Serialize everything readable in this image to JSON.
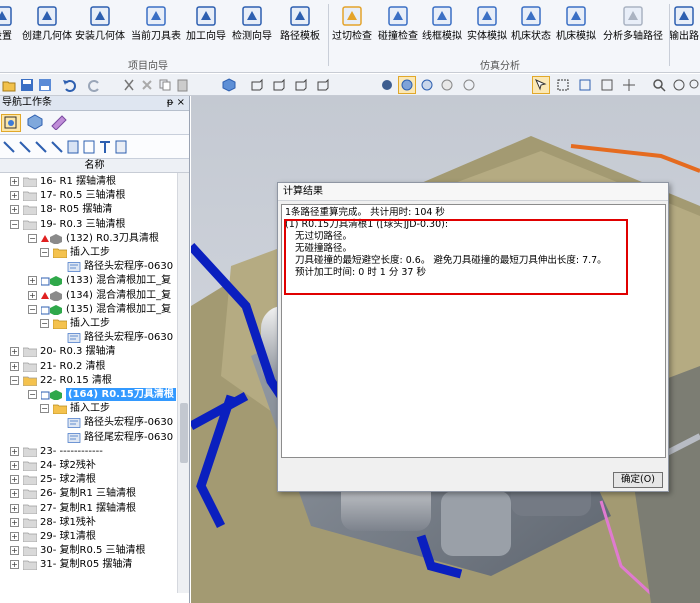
{
  "ribbon": {
    "buttons": [
      {
        "label": "设置",
        "icon": "settings-icon"
      },
      {
        "label": "创建几何体",
        "icon": "create-geometry-icon"
      },
      {
        "label": "安装几何体",
        "icon": "install-geometry-icon"
      },
      {
        "label": "当前刀具表",
        "icon": "tool-table-icon"
      },
      {
        "label": "加工向导",
        "icon": "machining-wizard-icon"
      },
      {
        "label": "检测向导",
        "icon": "check-wizard-icon"
      },
      {
        "label": "路径模板",
        "icon": "path-template-icon"
      },
      {
        "label": "过切检查",
        "icon": "overcut-check-icon"
      },
      {
        "label": "碰撞检查",
        "icon": "collision-check-icon"
      },
      {
        "label": "线框模拟",
        "icon": "wireframe-sim-icon"
      },
      {
        "label": "实体模拟",
        "icon": "solid-sim-icon"
      },
      {
        "label": "机床状态",
        "icon": "machine-state-icon"
      },
      {
        "label": "机床模拟",
        "icon": "machine-sim-icon"
      },
      {
        "label": "分析多轴路径",
        "icon": "multiaxis-analysis-icon"
      },
      {
        "label": "输出路",
        "icon": "output-path-icon"
      }
    ],
    "groups": [
      "项目向导",
      "仿真分析"
    ]
  },
  "panel": {
    "title": "导航工作条",
    "pin": "ᵽ ×",
    "column_header": "名称"
  },
  "tree": [
    {
      "id": "16",
      "label": "16- R1 摆轴清根",
      "level": 0,
      "kind": "folder",
      "expand": "+"
    },
    {
      "id": "17",
      "label": "17- R0.5 三轴清根",
      "level": 0,
      "kind": "folder",
      "expand": "+"
    },
    {
      "id": "18",
      "label": "18- R05 摆轴清",
      "level": 0,
      "kind": "folder",
      "expand": "+"
    },
    {
      "id": "19",
      "label": "19- R0.3 三轴清根",
      "level": 0,
      "kind": "folder",
      "expand": "−"
    },
    {
      "id": "132",
      "label": "(132) R0.3刀具清根",
      "level": 1,
      "kind": "op-warn",
      "expand": "−"
    },
    {
      "id": "132s",
      "label": "插入工步",
      "level": 2,
      "kind": "step",
      "expand": "−"
    },
    {
      "id": "132m",
      "label": "路径头宏程序-0630",
      "level": 3,
      "kind": "macro"
    },
    {
      "id": "133",
      "label": "(133) 混合清根加工_复",
      "level": 1,
      "kind": "op-ok",
      "expand": "+"
    },
    {
      "id": "134",
      "label": "(134) 混合清根加工_复",
      "level": 1,
      "kind": "op-warn",
      "expand": "+"
    },
    {
      "id": "135",
      "label": "(135) 混合清根加工_复",
      "level": 1,
      "kind": "op-ok",
      "expand": "−"
    },
    {
      "id": "135s",
      "label": "插入工步",
      "level": 2,
      "kind": "step",
      "expand": "−"
    },
    {
      "id": "135m",
      "label": "路径头宏程序-0630",
      "level": 3,
      "kind": "macro"
    },
    {
      "id": "20",
      "label": "20- R0.3 摆轴清",
      "level": 0,
      "kind": "folder",
      "expand": "+"
    },
    {
      "id": "21",
      "label": "21- R0.2 清根",
      "level": 0,
      "kind": "folder",
      "expand": "+"
    },
    {
      "id": "22",
      "label": "22- R0.15 清根",
      "level": 0,
      "kind": "folder-open",
      "expand": "−"
    },
    {
      "id": "164",
      "label": "(164) R0.15刀具清根",
      "level": 1,
      "kind": "op-selected",
      "expand": "−"
    },
    {
      "id": "164s",
      "label": "插入工步",
      "level": 2,
      "kind": "step",
      "expand": "−"
    },
    {
      "id": "164m1",
      "label": "路径头宏程序-0630",
      "level": 3,
      "kind": "macro"
    },
    {
      "id": "164m2",
      "label": "路径尾宏程序-0630",
      "level": 3,
      "kind": "macro"
    },
    {
      "id": "23",
      "label": "23- ------------",
      "level": 0,
      "kind": "folder",
      "expand": "+"
    },
    {
      "id": "24",
      "label": "24- 球2残补",
      "level": 0,
      "kind": "folder",
      "expand": "+"
    },
    {
      "id": "25",
      "label": "25- 球2清根",
      "level": 0,
      "kind": "folder",
      "expand": "+"
    },
    {
      "id": "26",
      "label": "26- 复制R1 三轴清根",
      "level": 0,
      "kind": "folder",
      "expand": "+"
    },
    {
      "id": "27",
      "label": "27- 复制R1 摆轴清根",
      "level": 0,
      "kind": "folder",
      "expand": "+"
    },
    {
      "id": "28",
      "label": "28- 球1残补",
      "level": 0,
      "kind": "folder",
      "expand": "+"
    },
    {
      "id": "29",
      "label": "29- 球1清根",
      "level": 0,
      "kind": "folder",
      "expand": "+"
    },
    {
      "id": "30",
      "label": "30- 复制R0.5 三轴清根",
      "level": 0,
      "kind": "folder",
      "expand": "+"
    },
    {
      "id": "31",
      "label": "31- 复制R05 摆轴清",
      "level": 0,
      "kind": "folder",
      "expand": "+"
    }
  ],
  "dialog": {
    "title": "计算结果",
    "lines": [
      "1条路径重算完成。 共计用时: 104 秒",
      "(1) R0.15刀具清根1 ([球头]JD-0.30):",
      "    无过切路径。",
      "    无碰撞路径。",
      "    刀具碰撞的最短避空长度: 0.6。  避免刀具碰撞的最短刀具伸出长度: 7.7。",
      "    预计加工时间: 0 时 1 分 37 秒"
    ],
    "ok_label": "确定(O)"
  },
  "colors": {
    "highlight_box": "#e00000",
    "selection": "#3399ff",
    "viewport_bg": "#c5cad3"
  }
}
